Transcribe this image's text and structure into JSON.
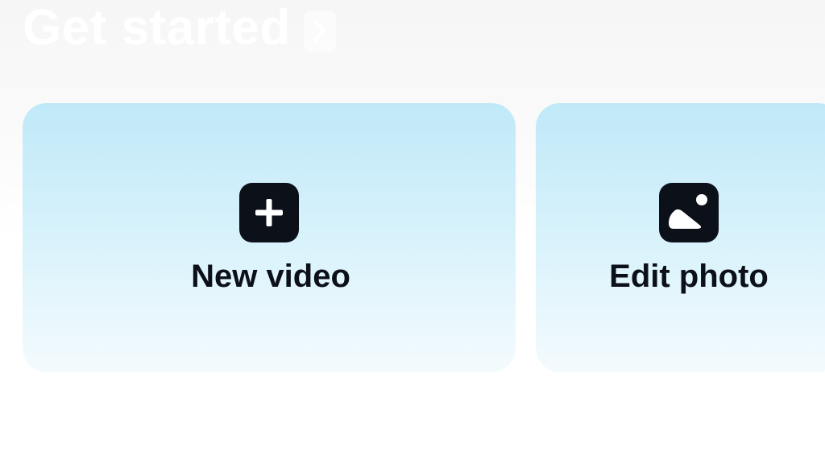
{
  "header": {
    "title": "Get started",
    "chevron_icon": "chevron-right-icon"
  },
  "actions": [
    {
      "label": "New video",
      "icon": "plus-icon"
    },
    {
      "label": "Edit photo",
      "icon": "image-icon"
    }
  ],
  "colors": {
    "card_gradient_top": "#c0e9f8",
    "card_gradient_bottom": "#f4fbfe",
    "icon_background": "#0c1018",
    "label_text": "#0c1018",
    "header_text": "#ffffff"
  }
}
